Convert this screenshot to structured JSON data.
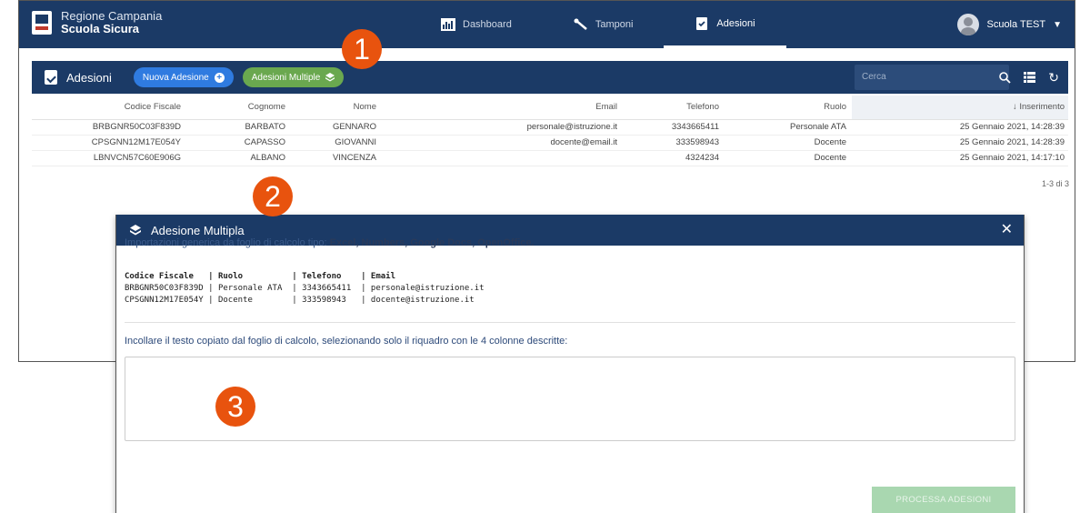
{
  "app": {
    "brand_line1": "Regione Campania",
    "brand_line2": "Scuola Sicura",
    "nav": [
      {
        "label": "Dashboard",
        "icon": "chart-icon"
      },
      {
        "label": "Tamponi",
        "icon": "swab-icon"
      },
      {
        "label": "Adesioni",
        "icon": "clipboard-check-icon"
      }
    ],
    "user": "Scuola TEST"
  },
  "toolbar": {
    "title": "Adesioni",
    "new_button": "Nuova Adesione",
    "multi_button": "Adesioni Multiple",
    "search_placeholder": "Cerca"
  },
  "table": {
    "headers": [
      "Codice Fiscale",
      "Cognome",
      "Nome",
      "Email",
      "Telefono",
      "Ruolo",
      "↓ Inserimento"
    ],
    "rows": [
      [
        "BRBGNR50C03F839D",
        "BARBATO",
        "GENNARO",
        "personale@istruzione.it",
        "3343665411",
        "Personale ATA",
        "25 Gennaio 2021, 14:28:39"
      ],
      [
        "CPSGNN12M17E054Y",
        "CAPASSO",
        "GIOVANNI",
        "docente@email.it",
        "333598943",
        "Docente",
        "25 Gennaio 2021, 14:28:39"
      ],
      [
        "LBNVCN57C60E906G",
        "ALBANO",
        "VINCENZA",
        "",
        "4324234",
        "Docente",
        "25 Gennaio 2021, 14:17:10"
      ]
    ],
    "pagination": "1-3 di 3"
  },
  "modal": {
    "title": "Adesione Multipla",
    "intro_prefix": "Importazioni generica da foglio di calcolo tipo: ",
    "intro_bold": "Excel, Numbers, Google Docs, OpenOffice.",
    "sample_header": "Codice Fiscale   | Ruolo          | Telefono    | Email",
    "sample_line1": "BRBGNR50C03F839D | Personale ATA  | 3343665411  | personale@istruzione.it",
    "sample_line2": "CPSGNN12M17E054Y | Docente        | 333598943   | docente@istruzione.it",
    "paste_label": "Incollare il testo copiato dal foglio di calcolo, selezionando solo il riquadro con le 4 colonne descritte:",
    "paste_value": "",
    "process_button": "PROCESSA ADESIONI"
  },
  "callouts": [
    "1",
    "2",
    "3"
  ],
  "colors": {
    "navy": "#1b3a66",
    "blue_pill": "#2f7be0",
    "green_pill": "#6aa84f",
    "callout": "#e8530e",
    "process_disabled": "#a9d7b0"
  }
}
